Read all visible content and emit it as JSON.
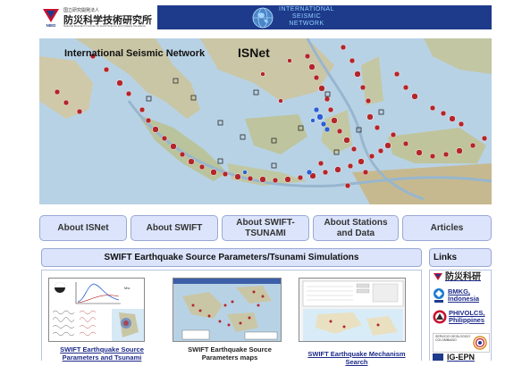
{
  "header": {
    "nied_small": "国立研究開発法人",
    "nied_name_jp": "防災科学技術研究所",
    "nied_name_en": "National Research Institute for Earth Science and Disaster Resilience",
    "nied_logo_text": "NIED",
    "isn_line1": "INTERNATIONAL",
    "isn_line2": "SEISMIC",
    "isn_line3": "NETWORK"
  },
  "banner": {
    "title": "International Seismic Network",
    "title_short": "ISNet"
  },
  "nav": [
    {
      "label": "About ISNet"
    },
    {
      "label": "About SWIFT"
    },
    {
      "label": "About SWIFT-TSUNAMI"
    },
    {
      "label": "About Stations and Data"
    },
    {
      "label": "Articles"
    }
  ],
  "section": {
    "title": "SWIFT Earthquake Source Parameters/Tsunami Simulations",
    "links_title": "Links"
  },
  "products": [
    {
      "caption": "SWIFT Earthquake Source Parameters and Tsunami"
    },
    {
      "caption": "SWIFT Earthquake Source Parameters maps"
    },
    {
      "caption": "SWIFT Earthquake Mechanism Search"
    }
  ],
  "links": [
    {
      "label": "防災科研"
    },
    {
      "label": "BMKG, Indonesia"
    },
    {
      "label": "PHIVOLCS, Philippines"
    },
    {
      "label": "SERVICIO GEOLOGICO COLOMBIANO"
    },
    {
      "label": "IG-EPN"
    }
  ],
  "colors": {
    "header_bg": "#1e3a8a",
    "button_bg": "#dbe4fb",
    "link": "#1d2a8a"
  }
}
